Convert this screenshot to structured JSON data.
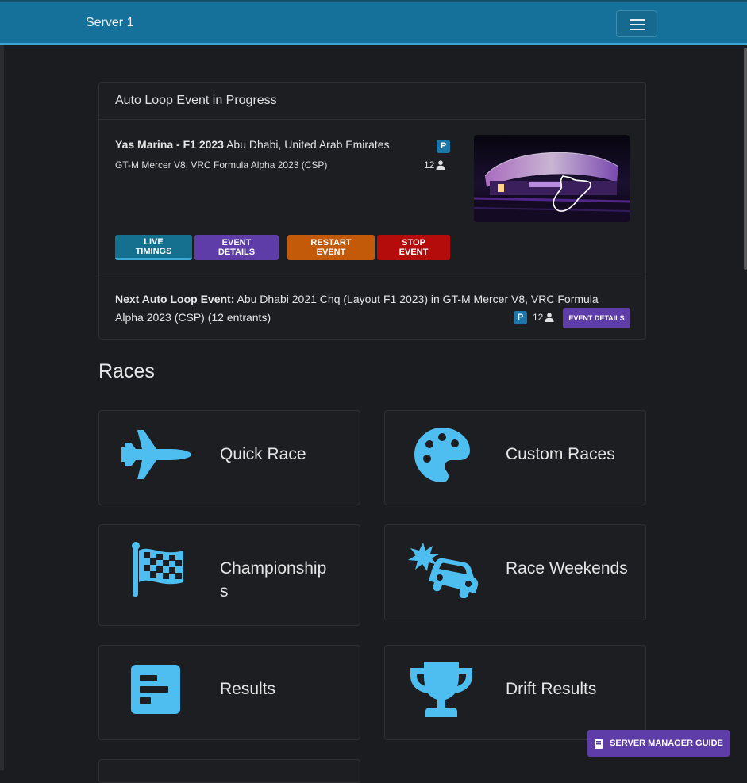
{
  "navbar": {
    "brand": "Server 1"
  },
  "event_card": {
    "header": "Auto Loop Event in Progress",
    "track_name": "Yas Marina - F1 2023",
    "track_location": "Abu Dhabi, United Arab Emirates",
    "cars": "GT-M Mercer V8, VRC Formula Alpha 2023 (CSP)",
    "badge": "P",
    "entrants": "12",
    "buttons": {
      "live_timings": "Live Timings",
      "event_details": "Event Details",
      "restart_event": "Restart Event",
      "stop_event": "Stop Event"
    },
    "next": {
      "label": "Next Auto Loop Event:",
      "description": "Abu Dhabi 2021 Chq (Layout F1 2023) in GT-M Mercer V8, VRC Formula Alpha 2023 (CSP) (12 entrants)",
      "badge": "P",
      "entrants": "12",
      "details_button": "Event Details"
    }
  },
  "races": {
    "title": "Races",
    "tiles": [
      {
        "label": "Quick Race",
        "icon": "fighter-jet-icon"
      },
      {
        "label": "Custom Races",
        "icon": "palette-icon"
      },
      {
        "label": "Championship\ns",
        "icon": "checkered-flag-icon"
      },
      {
        "label": "Race Weekends",
        "icon": "car-crash-icon"
      },
      {
        "label": "Results",
        "icon": "poll-icon"
      },
      {
        "label": "Drift Results",
        "icon": "trophy-icon"
      }
    ]
  },
  "guide_button": {
    "label": "Server Manager Guide",
    "icon": "book-icon"
  },
  "colors": {
    "accent": "#157199",
    "icon": "#4ebef0",
    "purple": "#5e3da8",
    "orange": "#c25a0a",
    "red": "#b40b0b"
  }
}
